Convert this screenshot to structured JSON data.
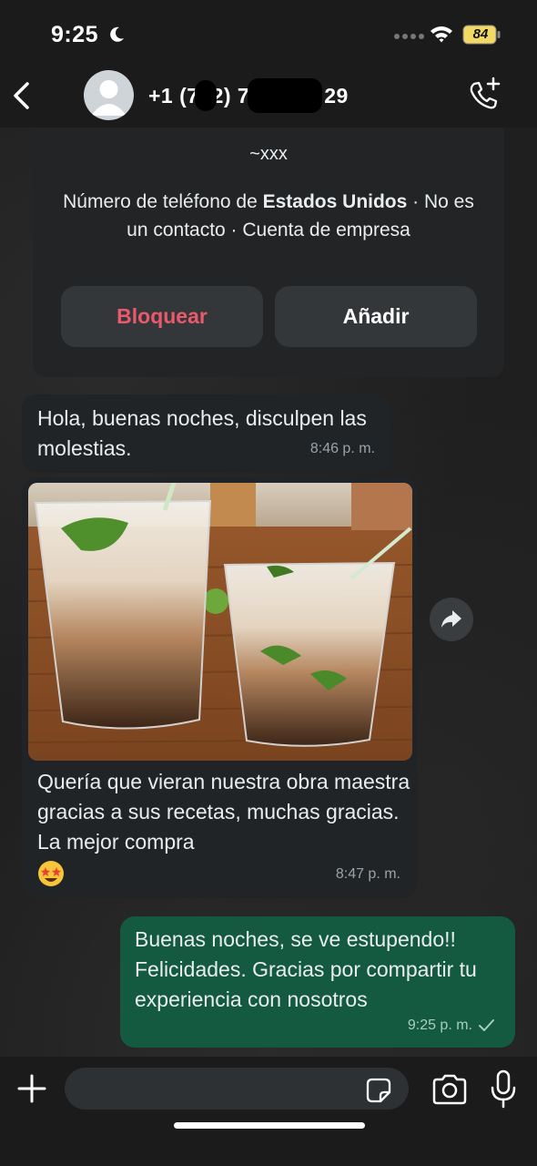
{
  "status_bar": {
    "time": "9:25",
    "battery": "84",
    "icons": [
      "moon-icon",
      "signal-dots-icon",
      "wifi-icon",
      "battery-icon"
    ]
  },
  "header": {
    "contact_prefix": "+1 (7",
    "contact_mid": "2) 7",
    "contact_suffix": "29",
    "icons": [
      "back-chevron-icon",
      "avatar-placeholder-icon",
      "add-call-icon"
    ]
  },
  "info_card": {
    "name": "~xxx",
    "line_part1": "Número de teléfono de ",
    "line_country": "Estados Unidos",
    "line_part2": " · No es un contacto · Cuenta de empresa",
    "block_label": "Bloquear",
    "add_label": "Añadir"
  },
  "messages": [
    {
      "direction": "in",
      "text": "Hola, buenas noches, disculpen las molestias.",
      "time": "8:46 p. m."
    },
    {
      "direction": "in",
      "has_photo": true,
      "text": "Quería que vieran nuestra obra maestra gracias a sus recetas, muchas gracias. La mejor compra",
      "emoji": "star-struck-emoji",
      "time": "8:47 p. m."
    },
    {
      "direction": "out",
      "text": "Buenas noches, se ve estupendo!! Felicidades. Gracias por compartir tu experiencia con nosotros",
      "time": "9:25 p. m.",
      "status": "sent-check-icon"
    }
  ],
  "input_bar": {
    "placeholder": "",
    "icons": [
      "plus-icon",
      "sticker-icon",
      "camera-icon",
      "microphone-icon"
    ]
  },
  "colors": {
    "outgoing_bubble": "#135a41",
    "incoming_bubble": "#212426",
    "block_red": "#ea5a6c"
  }
}
